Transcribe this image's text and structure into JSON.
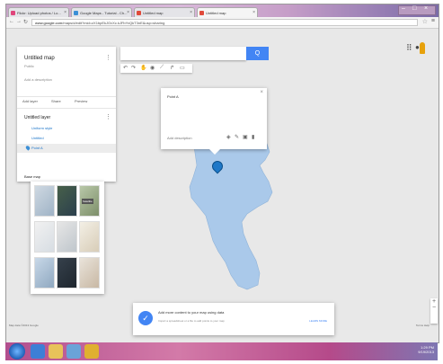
{
  "browser": {
    "tabs": [
      {
        "label": "Flickr: Upload photos / Lo...",
        "favicon_color": "#e0457b"
      },
      {
        "label": "Google Maps - Tutorial - Ch...",
        "favicon_color": "#3b8fd6"
      },
      {
        "label": "Untitled map",
        "favicon_color": "#e04a3a"
      },
      {
        "label": "Untitled map",
        "favicon_color": "#e04a3a"
      }
    ],
    "active_tab": 3,
    "url_domain": "www.google.com",
    "url_path": "/maps/d/edit?mid=zX1bpEkJGvXc.kJFbYvQkT3nE&usp=sharing"
  },
  "panel": {
    "title": "Untitled map",
    "subtitle": "Public",
    "description": "Add a description",
    "actions": [
      "Add layer",
      "Share",
      "Preview"
    ],
    "layer_title": "Untitled layer",
    "layer_items": [
      "Uniform style",
      "Untitled",
      "Point A"
    ],
    "basemap_label": "Base map",
    "basemap_thumb_label": "Satellite"
  },
  "toolbar": {
    "search_button": "Q"
  },
  "card": {
    "title": "Point A",
    "meta": "Add description"
  },
  "notification": {
    "title": "Add more content to your map using data",
    "subtitle": "Import a spreadsheet or a file to add points to your map",
    "link": "LEARN MORE"
  },
  "map_controls": {
    "zoom_in": "+",
    "zoom_out": "−"
  },
  "footer": {
    "left": "Map data ©2013 Google",
    "right": "Terms  Help"
  },
  "taskbar": {
    "time": "1:29 PM",
    "date": "9/19/2013"
  },
  "colors": {
    "water_fill": "#aac9ea",
    "accent": "#4285f4",
    "map_bg": "#e8e8e8",
    "marker": "#1f78c8"
  }
}
